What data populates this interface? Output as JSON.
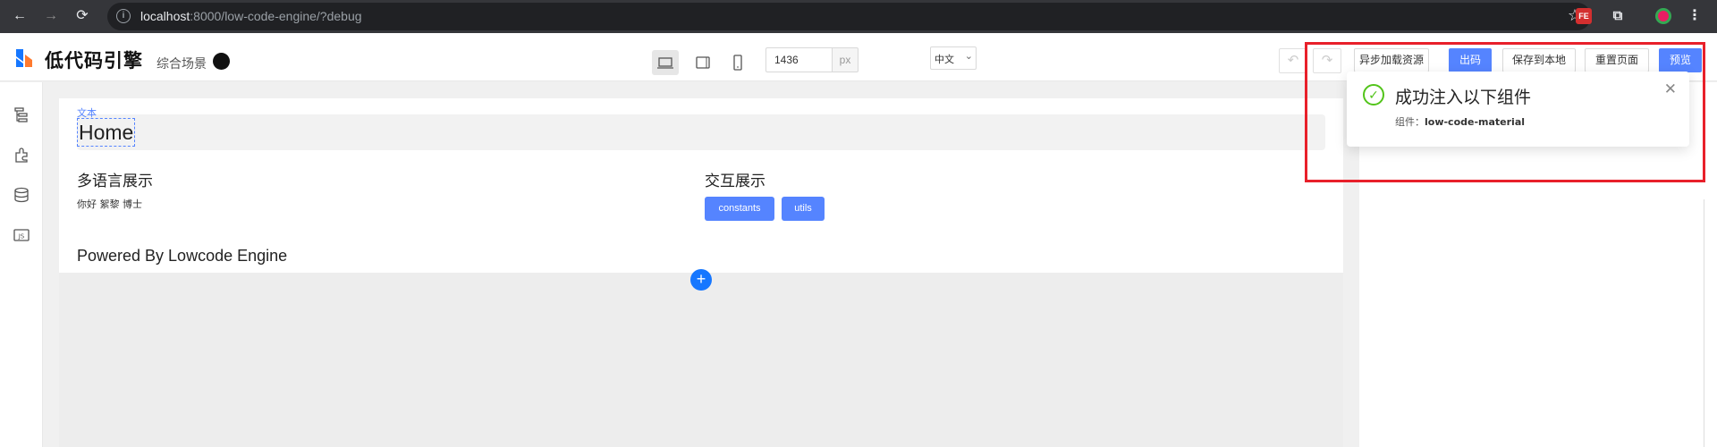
{
  "browser": {
    "url_host": "localhost",
    "url_rest": ":8000/low-code-engine/?debug",
    "ext_fe_label": "FE"
  },
  "toolbar": {
    "app_name": "低代码引擎",
    "scene": "综合场景",
    "width_value": "1436",
    "width_unit": "px",
    "locale": "中文",
    "buttons": [
      "异步加载资源",
      "出码",
      "保存到本地",
      "重置页面",
      "预览"
    ]
  },
  "canvas": {
    "text_tag": "文本",
    "home_title": "Home",
    "i18n_title": "多语言展示",
    "i18n_text": "你好 絮黎 博士",
    "interaction_title": "交互展示",
    "buttons": [
      "constants",
      "utils"
    ],
    "footer": "Powered By Lowcode Engine"
  },
  "notification": {
    "title": "成功注入以下组件",
    "desc_label": "组件：",
    "desc_value": "low-code-material"
  },
  "colors": {
    "primary": "#5584ff",
    "success": "#52c41a",
    "highlight": "#e8202a",
    "browser_bar": "#35363a"
  },
  "icons": {
    "left_rail": [
      "outline-tree-icon",
      "component-library-icon",
      "datasource-icon",
      "js-code-icon"
    ]
  }
}
